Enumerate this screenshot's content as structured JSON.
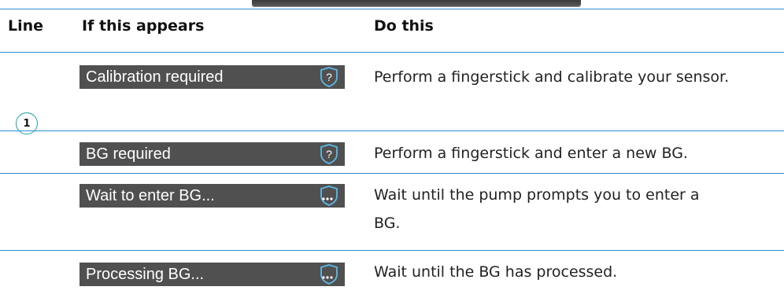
{
  "table": {
    "headers": {
      "line": "Line",
      "if_appears": "If this appears",
      "do_this": "Do this"
    },
    "rows": [
      {
        "line": "1",
        "screen_text": "Calibration required",
        "icon": "question-shield-icon",
        "action": "Perform a fingerstick and calibrate your sensor."
      },
      {
        "line": "",
        "screen_text": "BG required",
        "icon": "question-shield-icon",
        "action": "Perform a fingerstick and enter a new BG."
      },
      {
        "line": "",
        "screen_text": "Wait to enter BG...",
        "icon": "dots-shield-icon",
        "action_line1": "Wait until the pump prompts you to enter a",
        "action_line2": "BG."
      },
      {
        "line": "",
        "screen_text": "Processing BG...",
        "icon": "dots-shield-icon",
        "action": "Wait until the BG has processed."
      }
    ]
  },
  "colors": {
    "rule": "#2a8fd0",
    "screen_bg": "#505050",
    "marker": "#1aa0a0"
  }
}
